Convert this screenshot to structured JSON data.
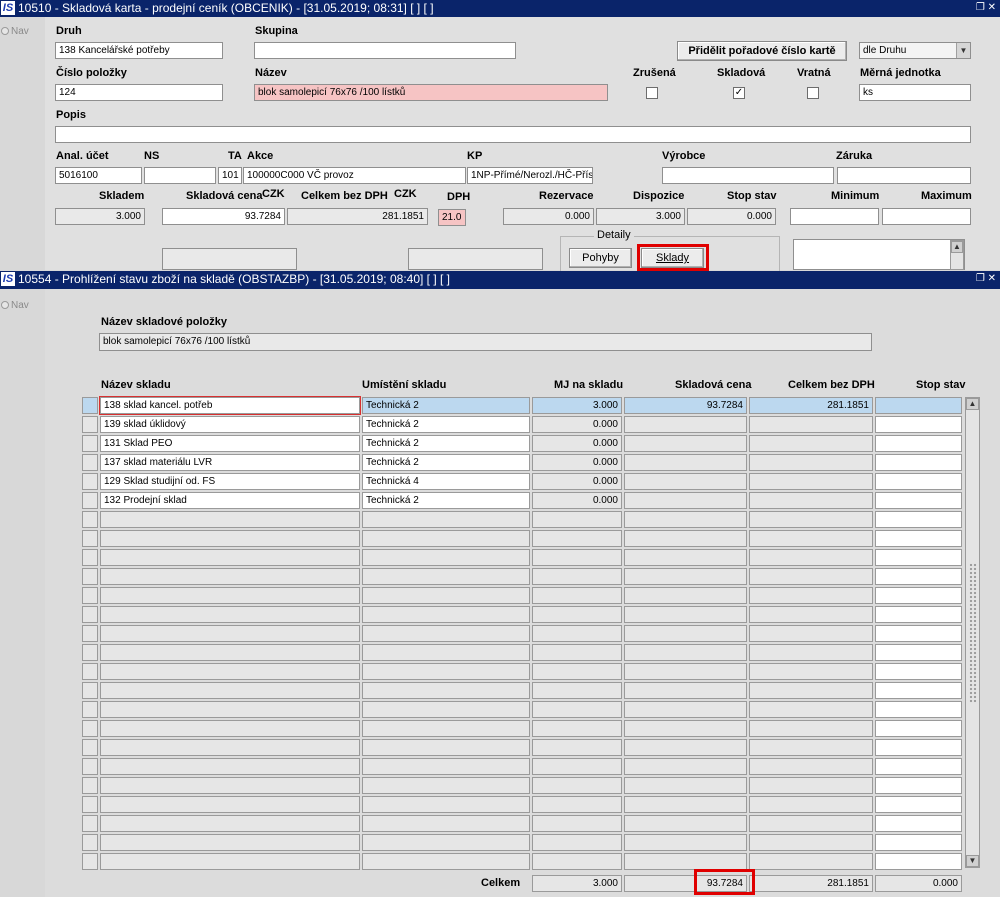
{
  "window1": {
    "title": "10510 - Skladová karta - prodejní ceník (OBCENIK) - [31.05.2019; 08:31]  [ ]  [ ]",
    "nav_label": "Nav",
    "labels": {
      "druh": "Druh",
      "skupina": "Skupina",
      "cislo": "Číslo položky",
      "nazev": "Název",
      "zrusena": "Zrušená",
      "skladova": "Skladová",
      "vratna": "Vratná",
      "merna": "Měrná jednotka",
      "popis": "Popis",
      "anal": "Anal. účet",
      "ns": "NS",
      "ta": "TA",
      "akce": "Akce",
      "kp": "KP",
      "vyrobce": "Výrobce",
      "zaruka": "Záruka",
      "skladem": "Skladem",
      "skladova_cena": "Skladová cena",
      "czk1": "CZK",
      "celkem_bez_dph": "Celkem bez DPH",
      "czk2": "CZK",
      "dph": "DPH",
      "rezervace": "Rezervace",
      "dispozice": "Dispozice",
      "stop_stav": "Stop stav",
      "minimum": "Minimum",
      "maximum": "Maximum",
      "detaily": "Detaily"
    },
    "values": {
      "druh": "138 Kancelářské potřeby",
      "skupina": "",
      "cislo": "124",
      "nazev": "blok samolepicí 76x76 /100 lístků",
      "merna": "ks",
      "popis": "",
      "anal": "5016100",
      "ns": "",
      "ta": "101",
      "akce": "100000C000 VČ provoz",
      "kp": "1NP-Přímé/Nerozl./HČ-Přísp",
      "vyrobce": "",
      "zaruka": "",
      "skladem": "3.000",
      "skladova_cena": "93.7284",
      "celkem_bez_dph": "281.1851",
      "dph": "21.0",
      "rezervace": "0.000",
      "dispozice": "3.000",
      "stop_stav": "0.000",
      "minimum": "",
      "maximum": ""
    },
    "checkboxes": {
      "zrusena": "",
      "skladova": "✓",
      "vratna": ""
    },
    "buttons": {
      "pridelit": "Přidělit pořadové číslo kartě",
      "dropdown": "dle Druhu",
      "pohyby": "Pohyby",
      "sklady": "Sklady"
    }
  },
  "window2": {
    "title": "10554 - Prohlížení stavu zboží na skladě (OBSTAZBP) - [31.05.2019; 08:40]  [ ]  [ ]",
    "nav_label": "Nav",
    "item_label": "Název skladové položky",
    "item_value": "blok samolepicí 76x76 /100 lístků",
    "columns": [
      "Název skladu",
      "Umístění skladu",
      "MJ na skladu",
      "Skladová cena",
      "Celkem bez DPH",
      "Stop stav"
    ],
    "rows": [
      [
        "138 sklad kancel. potřeb",
        "Technická 2",
        "3.000",
        "93.7284",
        "281.1851",
        ""
      ],
      [
        "139 sklad úklidový",
        "Technická 2",
        "0.000",
        "",
        "",
        ""
      ],
      [
        "131 Sklad PEO",
        "Technická 2",
        "0.000",
        "",
        "",
        ""
      ],
      [
        "137 sklad materiálu LVR",
        "Technická 2",
        "0.000",
        "",
        "",
        ""
      ],
      [
        "129 Sklad studijní od. FS",
        "Technická 4",
        "0.000",
        "",
        "",
        ""
      ],
      [
        "132 Prodejní sklad",
        "Technická 2",
        "0.000",
        "",
        "",
        ""
      ]
    ],
    "empty_rows": 19,
    "totals_label": "Celkem",
    "totals": [
      "3.000",
      "93.7284",
      "281.1851",
      "0.000"
    ]
  },
  "colors": {
    "titlebar": "#0a246a",
    "highlight": "#e00000",
    "selected_row": "#bcd8ef",
    "pink_field": "#f6c4c4"
  }
}
